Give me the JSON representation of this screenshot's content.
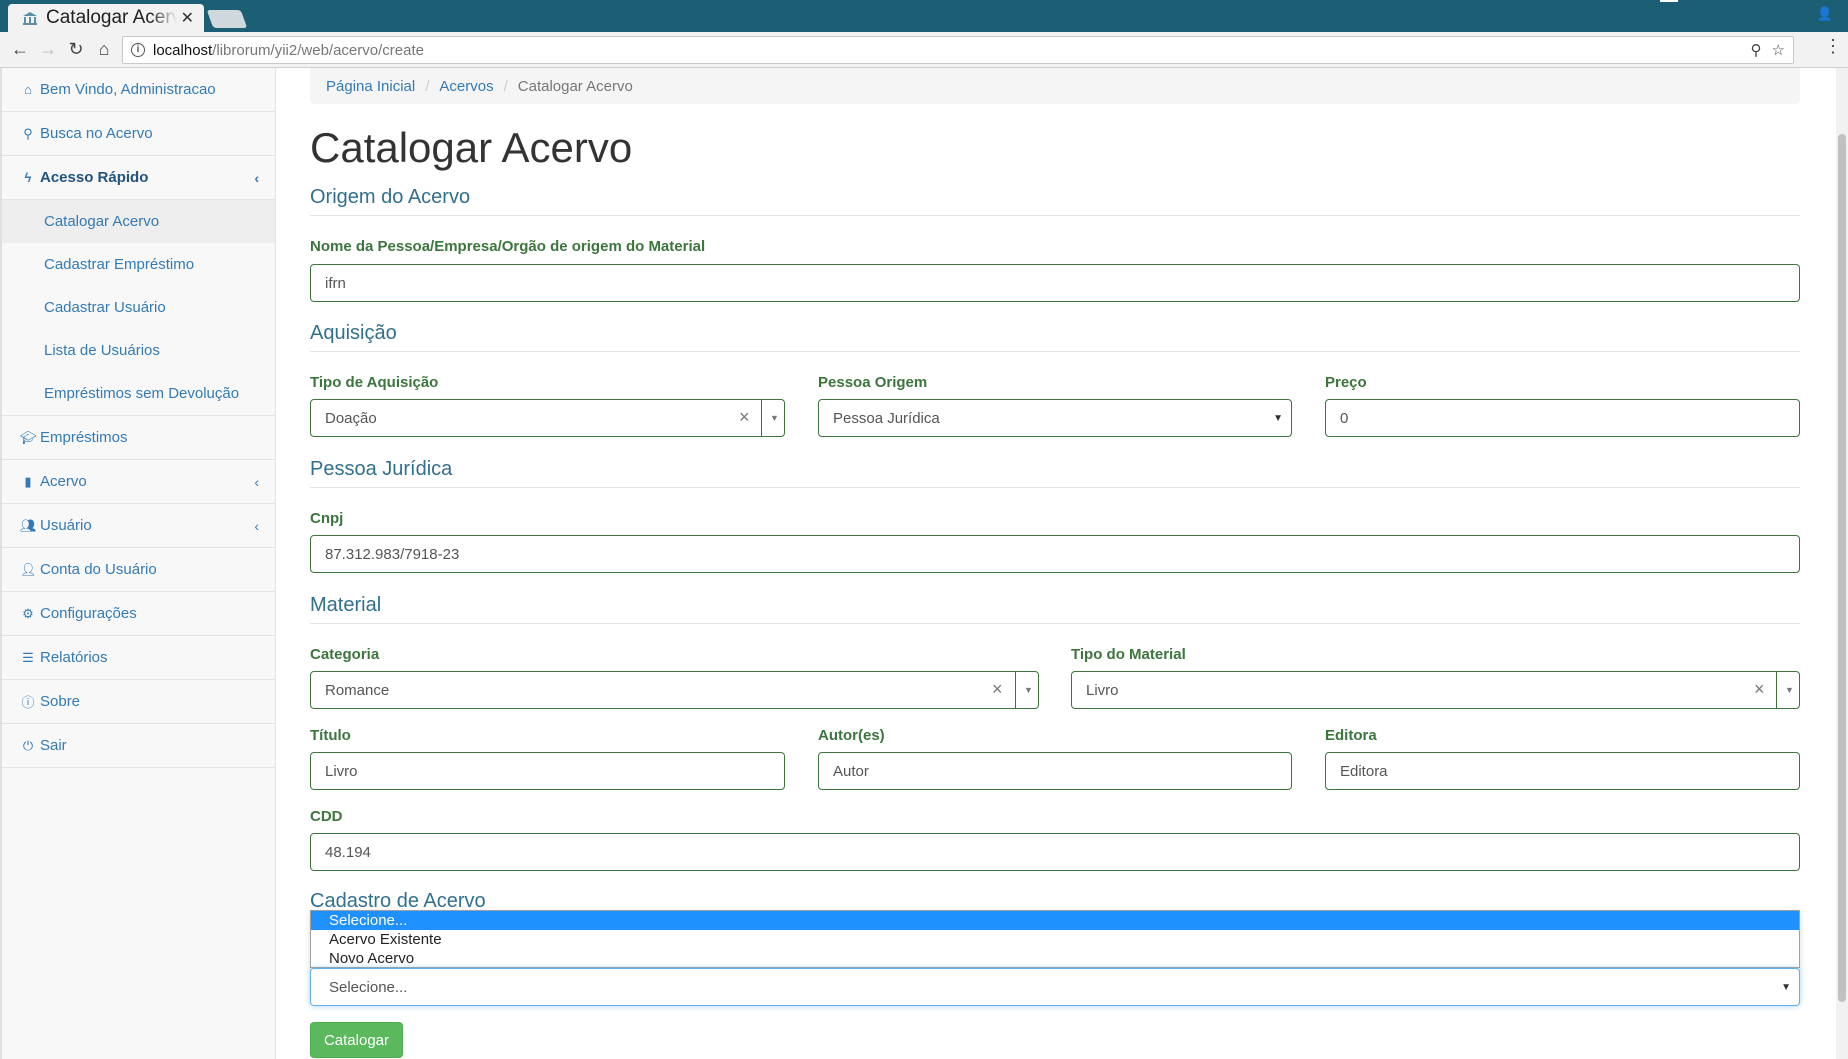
{
  "browser": {
    "tab_title": "Catalogar Acervo",
    "url_host": "localhost",
    "url_path": "/librorum/yii2/web/acervo/create"
  },
  "sidebar": {
    "items": [
      {
        "label": "Bem Vindo, Administracao",
        "icon": "home-icon"
      },
      {
        "label": "Busca no Acervo",
        "icon": "search-icon"
      },
      {
        "label": "Acesso Rápido",
        "icon": "bolt-icon"
      },
      {
        "label": "Empréstimos",
        "icon": "graduation-cap-icon"
      },
      {
        "label": "Acervo",
        "icon": "book-icon"
      },
      {
        "label": "Usuário",
        "icon": "users-icon"
      },
      {
        "label": "Conta do Usuário",
        "icon": "user-icon"
      },
      {
        "label": "Configurações",
        "icon": "gear-icon"
      },
      {
        "label": "Relatórios",
        "icon": "list-icon"
      },
      {
        "label": "Sobre",
        "icon": "info-icon"
      },
      {
        "label": "Sair",
        "icon": "power-icon"
      }
    ],
    "sub_items": [
      "Catalogar Acervo",
      "Cadastrar Empréstimo",
      "Cadastrar Usuário",
      "Lista de Usuários",
      "Empréstimos sem Devolução"
    ]
  },
  "breadcrumb": {
    "home": "Página Inicial",
    "parent": "Acervos",
    "current": "Catalogar Acervo"
  },
  "page_title": "Catalogar Acervo",
  "sections": {
    "origem": "Origem do Acervo",
    "aquisicao": "Aquisição",
    "pessoa_juridica": "Pessoa Jurídica",
    "material": "Material",
    "cadastro": "Cadastro de Acervo"
  },
  "form": {
    "origem_nome": {
      "label": "Nome da Pessoa/Empresa/Orgão de origem do Material",
      "value": "ifrn"
    },
    "tipo_aquisicao": {
      "label": "Tipo de Aquisição",
      "value": "Doação"
    },
    "pessoa_origem": {
      "label": "Pessoa Origem",
      "value": "Pessoa Jurídica"
    },
    "preco": {
      "label": "Preço",
      "value": "0"
    },
    "cnpj": {
      "label": "Cnpj",
      "value": "87.312.983/7918-23"
    },
    "categoria": {
      "label": "Categoria",
      "value": "Romance"
    },
    "tipo_material": {
      "label": "Tipo do Material",
      "value": "Livro"
    },
    "titulo": {
      "label": "Título",
      "value": "Livro"
    },
    "autor": {
      "label": "Autor(es)",
      "value": "Autor"
    },
    "editora": {
      "label": "Editora",
      "value": "Editora"
    },
    "cdd": {
      "label": "CDD",
      "value": "48.194"
    },
    "cadastro_select": {
      "value": "Selecione...",
      "options": [
        "Selecione...",
        "Acervo Existente",
        "Novo Acervo"
      ]
    },
    "submit_label": "Catalogar"
  }
}
